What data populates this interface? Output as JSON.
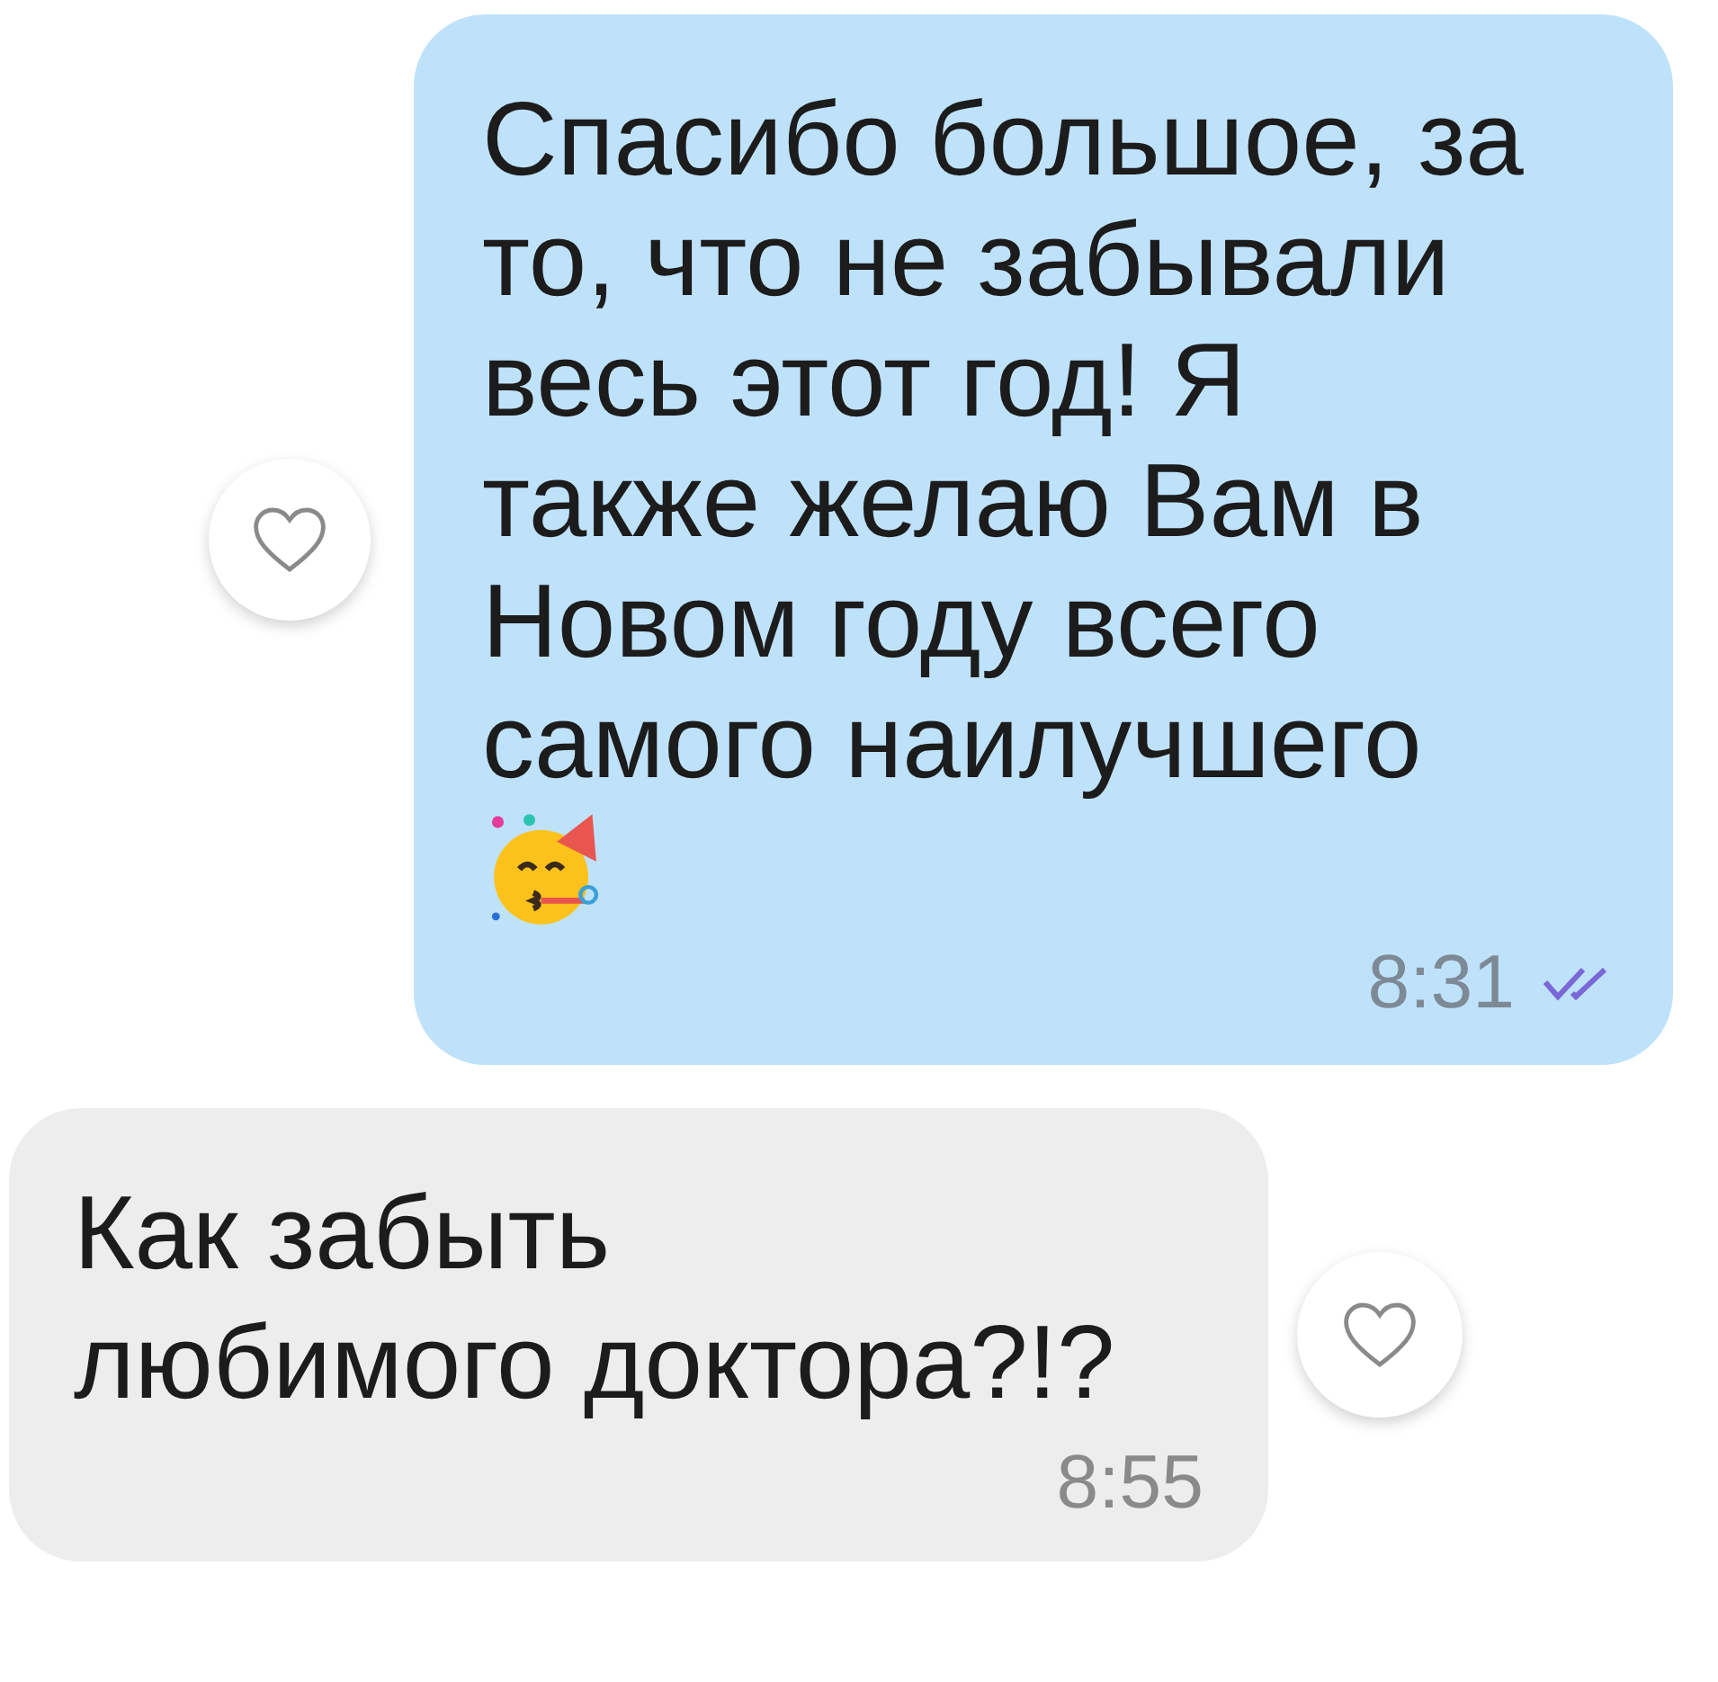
{
  "messages": [
    {
      "kind": "outgoing",
      "text": "Спасибо большое, за\nто, что не забывали\nвесь этот год! Я\nтакже желаю Вам в\nНовом году всего\nсамого наилучшего",
      "emoji": true,
      "time": "8:31",
      "read": true
    },
    {
      "kind": "incoming",
      "text": "Как забыть\nлюбимого доктора?!?",
      "emoji": false,
      "time": "8:55",
      "read": false
    }
  ]
}
